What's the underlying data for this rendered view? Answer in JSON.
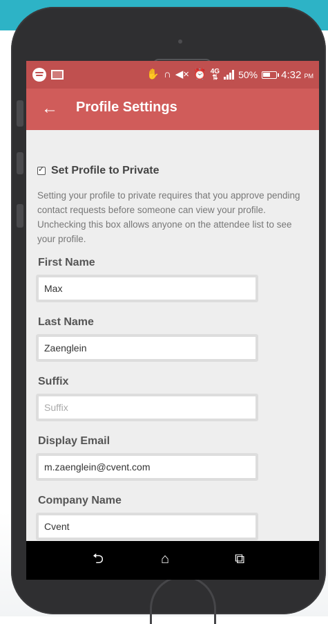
{
  "status_bar": {
    "time": "4:32",
    "time_suffix": "PM",
    "battery": "50%",
    "network": "4G",
    "icons": [
      "spotify-icon",
      "message-icon",
      "hand-icon",
      "headphones-icon",
      "mute-icon",
      "alarm-icon",
      "lte-icon",
      "signal-icon",
      "battery-icon"
    ]
  },
  "app_bar": {
    "title": "Profile Settings",
    "back_icon": "arrow-left-icon"
  },
  "privacy": {
    "label": "Set Profile to Private",
    "checked": true,
    "description": "Setting your profile to private requires that you approve pending contact requests before someone can view your profile. Unchecking this box allows anyone on the attendee list to see your profile."
  },
  "fields": [
    {
      "label": "First Name",
      "value": "Max",
      "placeholder": "First Name"
    },
    {
      "label": "Last Name",
      "value": "Zaenglein",
      "placeholder": "Last Name"
    },
    {
      "label": "Suffix",
      "value": "",
      "placeholder": "Suffix"
    },
    {
      "label": "Display Email",
      "value": "m.zaenglein@cvent.com",
      "placeholder": "Display Email"
    },
    {
      "label": "Company Name",
      "value": "Cvent",
      "placeholder": "Company Name"
    }
  ],
  "nav_bar": {
    "back": "⮌",
    "home": "⌂",
    "recents": "⧉"
  },
  "colors": {
    "status_bar": "#c0504f",
    "app_bar": "#d05c5a",
    "teal": "#2db3c6",
    "phone_body": "#2f2f31"
  }
}
